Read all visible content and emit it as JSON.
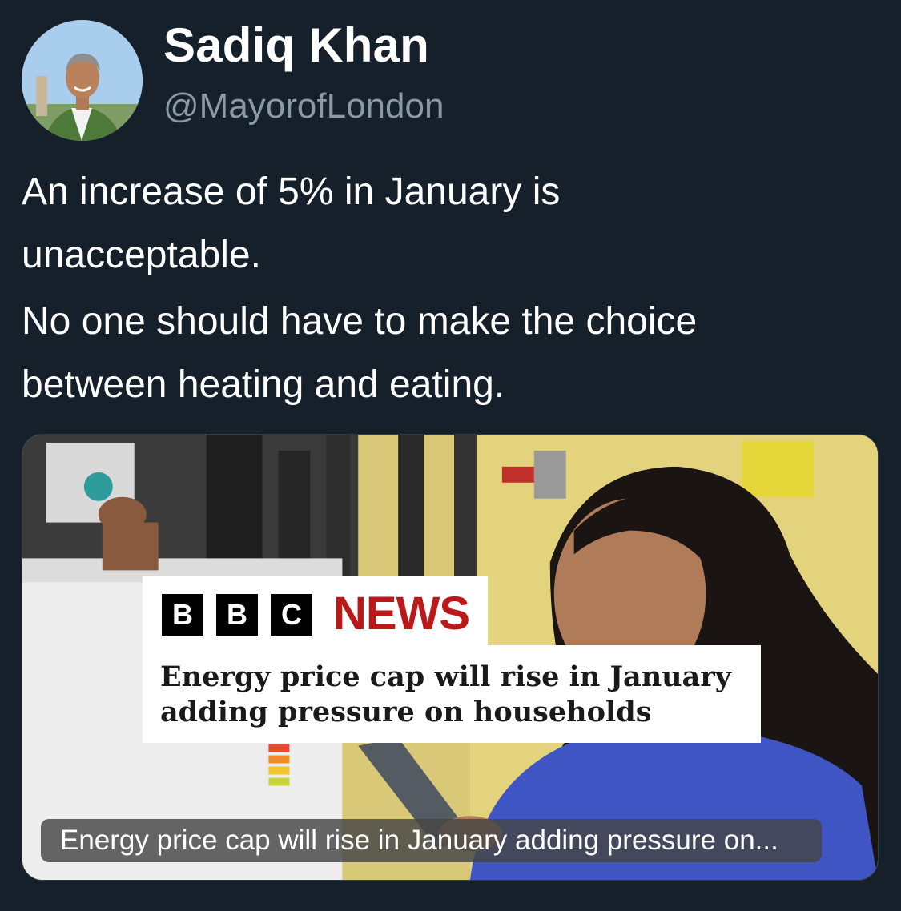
{
  "author": {
    "display_name": "Sadiq Khan",
    "handle": "@MayorofLondon",
    "avatar_icon": "profile-photo"
  },
  "tweet": {
    "paragraphs": [
      [
        "An increase of 5% in January is",
        "unacceptable."
      ],
      [
        "No one should have to make the choice",
        "between heating and eating."
      ]
    ]
  },
  "link_card": {
    "bbc_blocks": [
      "B",
      "B",
      "C"
    ],
    "bbc_news_word": "NEWS",
    "image_headline_lines": [
      "Energy price cap will rise in January",
      "adding pressure on households"
    ],
    "caption": "Energy price cap will rise in January adding pressure on...",
    "colors": {
      "bbc_red": "#bb1919",
      "background": "#15202b",
      "handle_gray": "#8b98a5"
    }
  }
}
